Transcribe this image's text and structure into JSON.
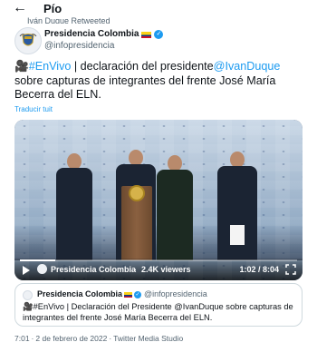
{
  "header": {
    "back_icon": "arrow-left-icon",
    "title": "Pío"
  },
  "retweet_context": "Iván Duque Retweeted",
  "author": {
    "name": "Presidencia Colombia",
    "handle": "@infopresidencia",
    "verified": true
  },
  "tweet": {
    "emoji": "🎥",
    "hashtag": "#EnVivo",
    "text_1": " | declaración del presidente",
    "mention": "@IvanDuque",
    "text_2": " sobre capturas de integrantes del frente José María Becerra del ELN.",
    "translate_label": "Traducir tuit"
  },
  "video": {
    "channel_name": "Presidencia Colombia",
    "separator": "·",
    "views": "2.4K viewers",
    "time": "1:02 / 8:04",
    "progress": 0.128
  },
  "quote": {
    "name": "Presidencia Colombia",
    "handle": "@infopresidencia",
    "text": "🎥#EnVivo | Declaración del Presidente @IvanDuque sobre capturas de integrantes del frente José María Becerra del ELN."
  },
  "meta": {
    "time": "7:01",
    "date": "2 de febrero de 2022",
    "separator": "·",
    "source": "Twitter Media Studio"
  },
  "colors": {
    "link": "#1d9bf0",
    "text": "#0f1419",
    "muted": "#536471",
    "verified": "#1d9bf0"
  }
}
